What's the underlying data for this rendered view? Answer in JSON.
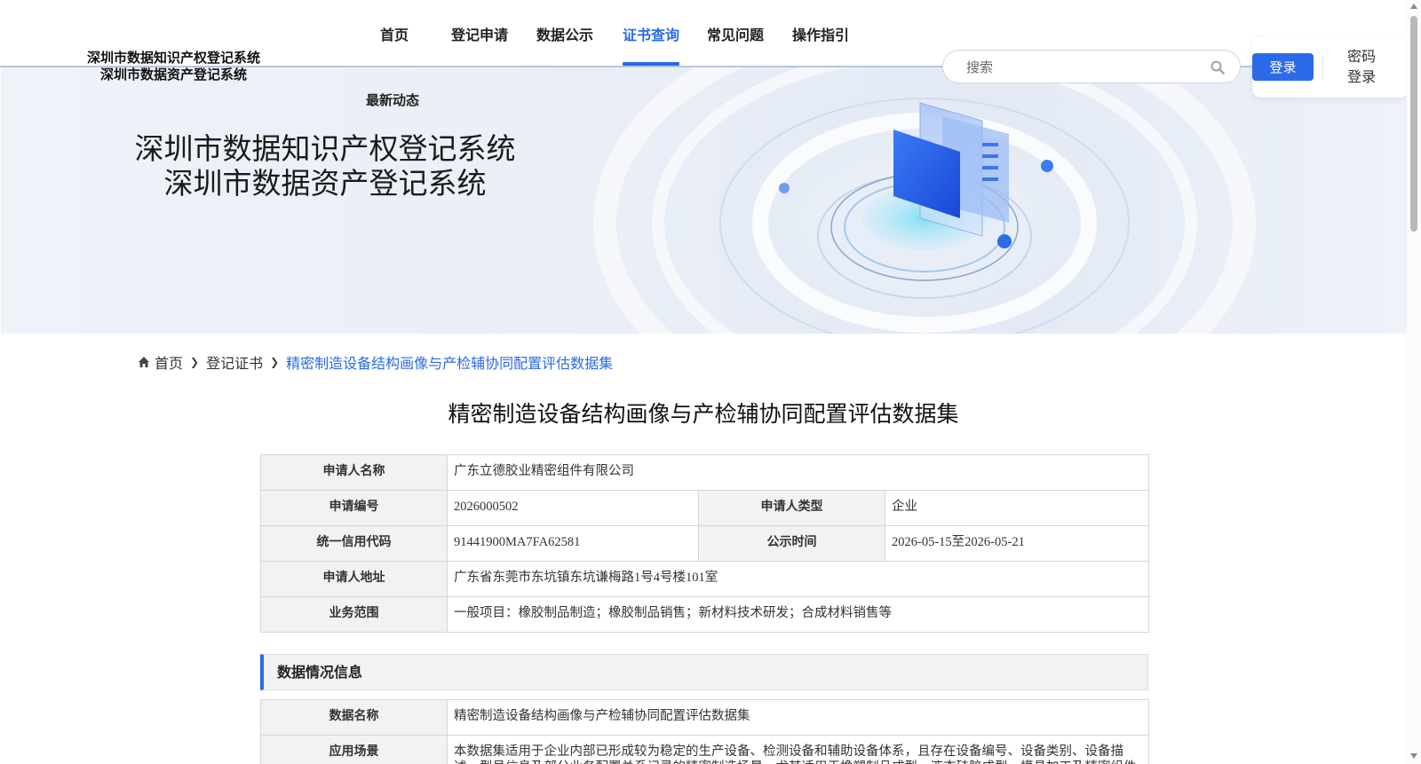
{
  "site": {
    "name_line1": "深圳市数据知识产权登记系统",
    "name_line2": "深圳市数据资产登记系统"
  },
  "nav": {
    "items": [
      {
        "label": "首页",
        "active": false
      },
      {
        "label": "登记申请",
        "active": false
      },
      {
        "label": "数据公示",
        "active": false
      },
      {
        "label": "证书查询",
        "active": true
      },
      {
        "label": "常见问题",
        "active": false
      },
      {
        "label": "操作指引",
        "active": false
      }
    ],
    "sub_item": "最新动态",
    "accent_color": "#2a6ae8"
  },
  "search": {
    "placeholder": "搜索",
    "icon": "search-icon"
  },
  "login": {
    "login_label": "登录",
    "password_login_label": "密码登录"
  },
  "banner": {
    "title_line1": "深圳市数据知识产权登记系统",
    "title_line2": "深圳市数据资产登记系统"
  },
  "breadcrumb": {
    "home": "首页",
    "level2": "登记证书",
    "current": "精密制造设备结构画像与产检辅协同配置评估数据集"
  },
  "page_title": "精密制造设备结构画像与产检辅协同配置评估数据集",
  "applicant": {
    "name_label": "申请人名称",
    "name_value": "广东立德胶业精密组件有限公司",
    "no_label": "申请编号",
    "no_value": "2026000502",
    "type_label": "申请人类型",
    "type_value": "企业",
    "credit_label": "统一信用代码",
    "credit_value": "91441900MA7FA62581",
    "pub_label": "公示时间",
    "pub_value": "2026-05-15至2026-05-21",
    "addr_label": "申请人地址",
    "addr_value": "广东省东莞市东坑镇东坑谦梅路1号4号楼101室",
    "scope_label": "业务范围",
    "scope_value": "一般项目：橡胶制品制造；橡胶制品销售；新材料技术研发；合成材料销售等"
  },
  "data_section": {
    "heading": "数据情况信息",
    "data_name_label": "数据名称",
    "data_name_value": "精密制造设备结构画像与产检辅协同配置评估数据集",
    "scenario_label": "应用场景",
    "scenario_value": "本数据集适用于企业内部已形成较为稳定的生产设备、检测设备和辅助设备体系，且存在设备编号、设备类别、设备描述、型号信息及部分业务配置关系记录的精密制造场景，尤其适用于橡塑制品成型、液态硅胶成型、模具加工及精密组件生产等业务"
  }
}
